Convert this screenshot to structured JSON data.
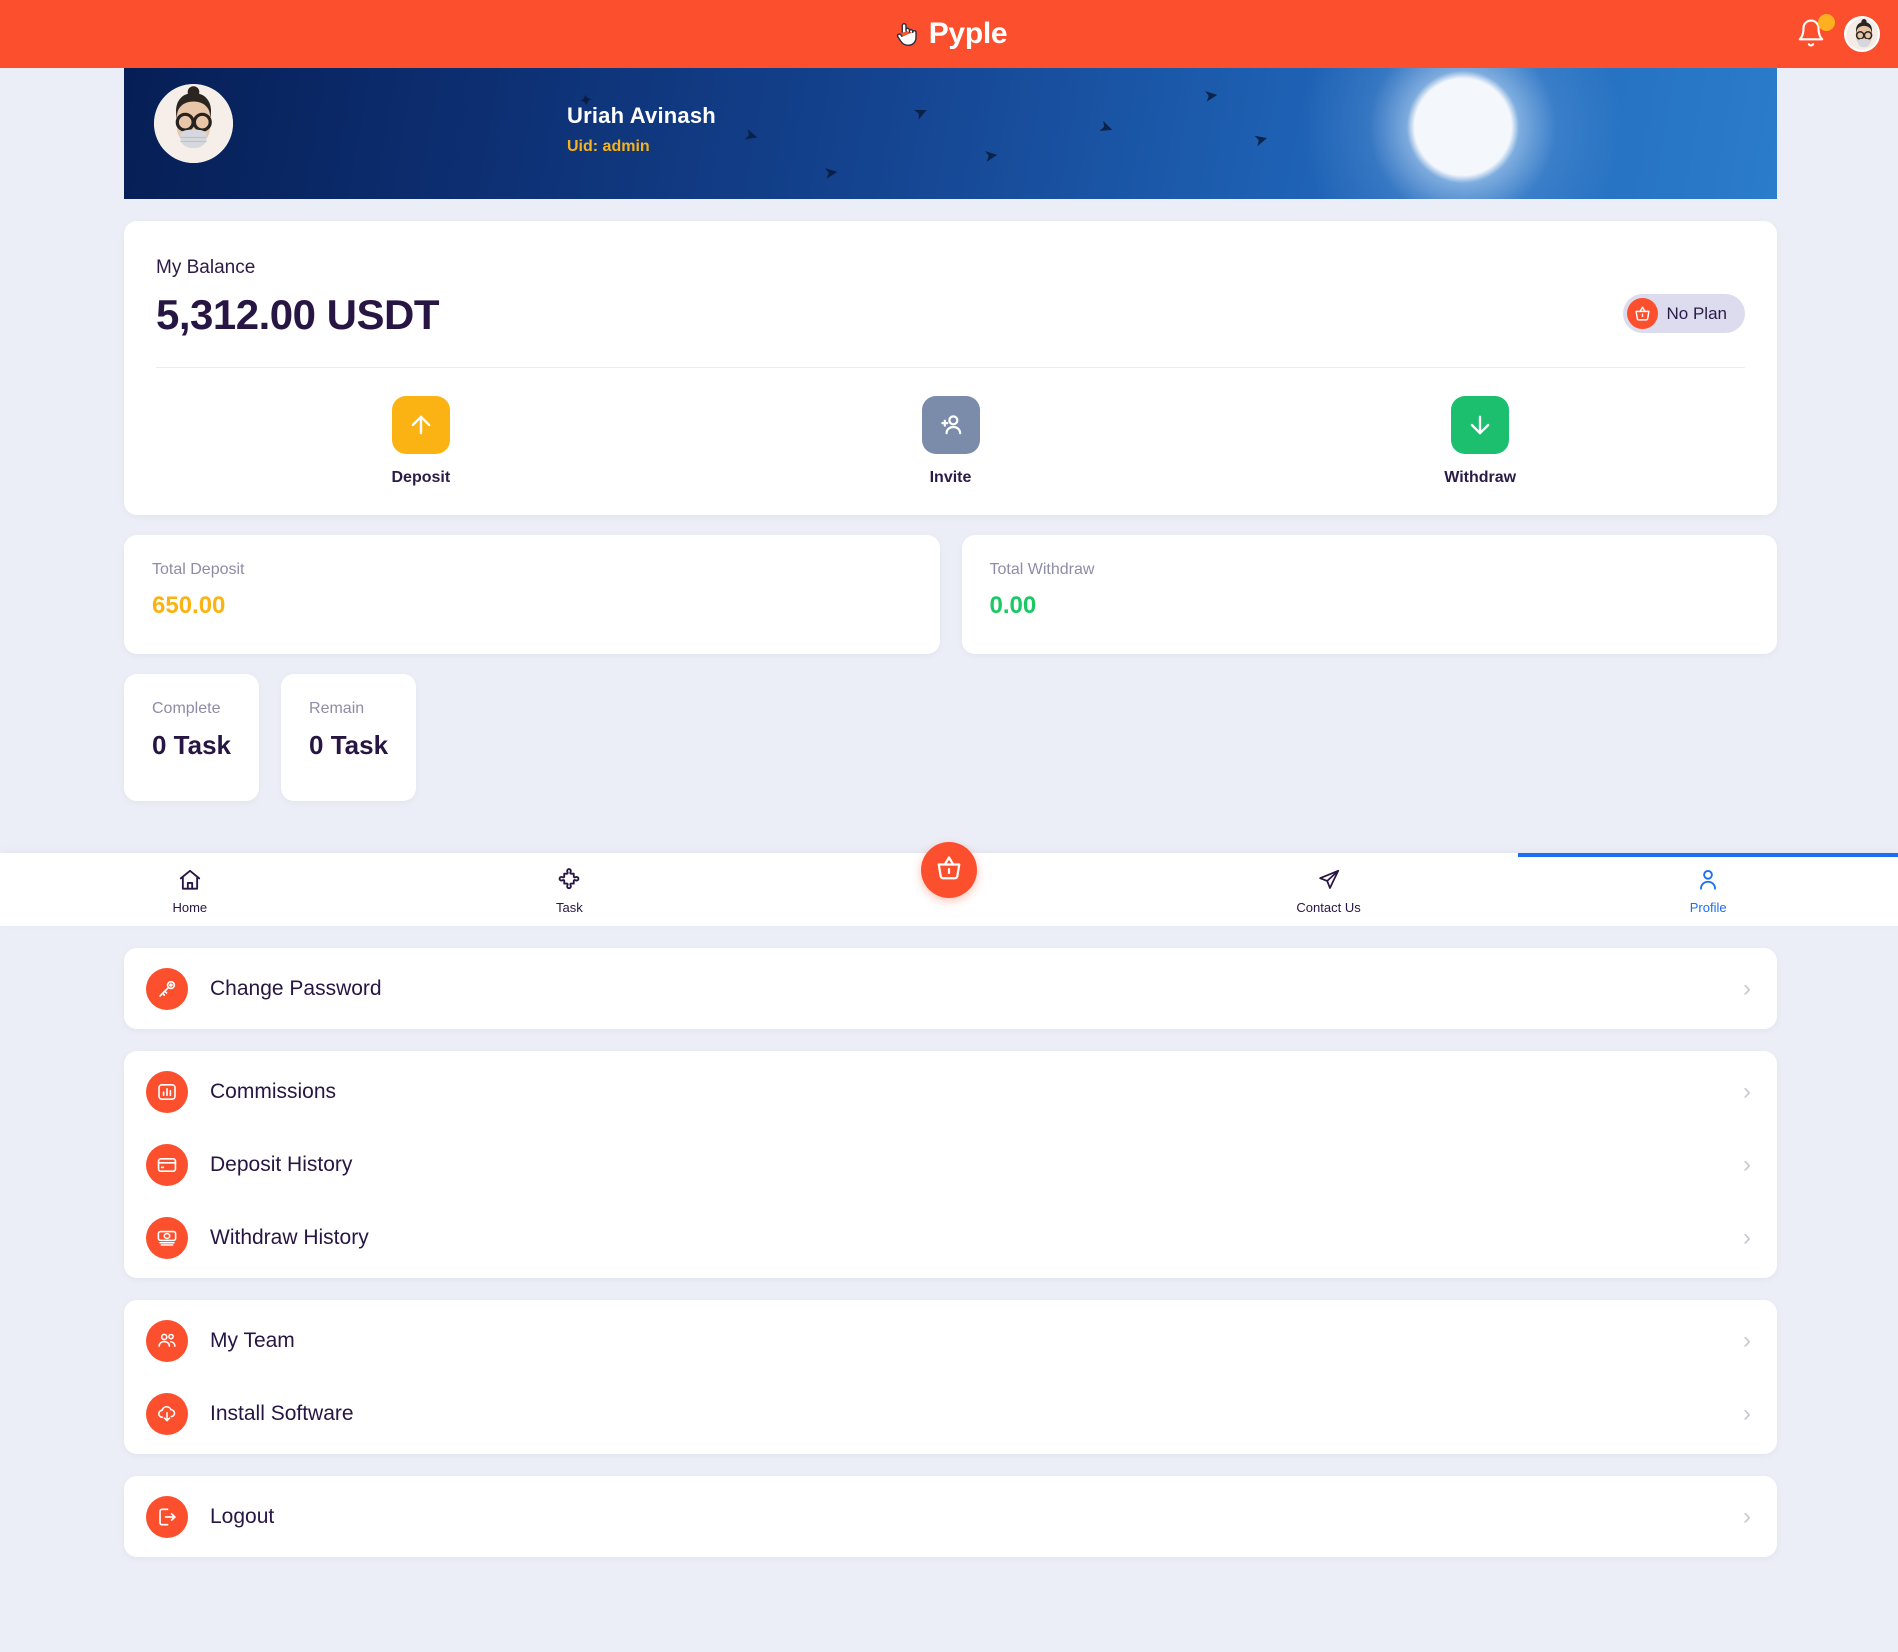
{
  "app": {
    "brand": "Pyple",
    "brand_icon": "pointing-hand-icon",
    "accent_color": "#fb4f2d",
    "bell_icon": "bell-icon",
    "avatar_icon": "user-avatar"
  },
  "banner": {
    "name": "Uriah Avinash",
    "uid": "Uid: admin"
  },
  "balance": {
    "label": "My Balance",
    "value": "5,312.00 USDT",
    "plan_badge": "No Plan",
    "plan_icon": "basket-icon"
  },
  "actions": [
    {
      "label": "Deposit",
      "icon": "arrow-up-icon",
      "color": "#fbb313"
    },
    {
      "label": "Invite",
      "icon": "person-add-icon",
      "color": "#7b8cab"
    },
    {
      "label": "Withdraw",
      "icon": "arrow-down-icon",
      "color": "#1bbf6e"
    }
  ],
  "stats": [
    {
      "label": "Total Deposit",
      "value": "650.00",
      "color": "#fbb313"
    },
    {
      "label": "Total Withdraw",
      "value": "0.00",
      "color": "#18c964"
    }
  ],
  "tasks": [
    {
      "label": "Complete",
      "value": "0 Task"
    },
    {
      "label": "Remain",
      "value": "0 Task"
    }
  ],
  "bottom_nav": [
    {
      "label": "Home",
      "icon": "home-icon",
      "active": false
    },
    {
      "label": "Task",
      "icon": "puzzle-icon",
      "active": false
    },
    {
      "label": "",
      "icon": "basket-icon",
      "active": false
    },
    {
      "label": "Contact Us",
      "icon": "paper-plane-icon",
      "active": false
    },
    {
      "label": "Profile",
      "icon": "person-icon",
      "active": true
    }
  ],
  "menu_groups": [
    {
      "items": [
        {
          "label": "Change Password",
          "icon": "key-icon"
        }
      ]
    },
    {
      "items": [
        {
          "label": "Commissions",
          "icon": "bar-chart-icon"
        },
        {
          "label": "Deposit History",
          "icon": "credit-card-icon"
        },
        {
          "label": "Withdraw History",
          "icon": "banknote-icon"
        }
      ]
    },
    {
      "items": [
        {
          "label": "My Team",
          "icon": "people-icon"
        },
        {
          "label": "Install Software",
          "icon": "cloud-download-icon"
        }
      ]
    },
    {
      "items": [
        {
          "label": "Logout",
          "icon": "logout-icon"
        }
      ]
    }
  ],
  "chevron": "›"
}
